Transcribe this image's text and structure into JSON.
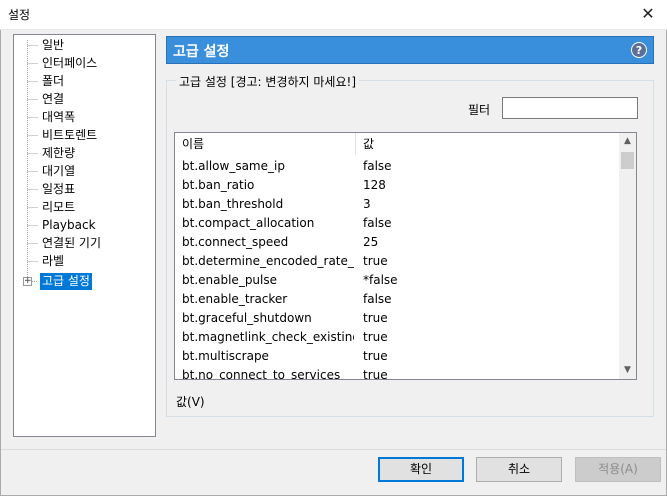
{
  "window": {
    "title": "설정",
    "close_glyph": "✕"
  },
  "tree": {
    "items": [
      {
        "label": "일반"
      },
      {
        "label": "인터페이스"
      },
      {
        "label": "폴더"
      },
      {
        "label": "연결"
      },
      {
        "label": "대역폭"
      },
      {
        "label": "비트토렌트"
      },
      {
        "label": "제한량"
      },
      {
        "label": "대기열"
      },
      {
        "label": "일정표"
      },
      {
        "label": "리모트"
      },
      {
        "label": "Playback"
      },
      {
        "label": "연결된 기기"
      },
      {
        "label": "라벨"
      },
      {
        "label": "고급 설정",
        "selected": true
      }
    ],
    "expander_glyph": "+"
  },
  "header": {
    "title": "고급 설정",
    "help_glyph": "?"
  },
  "group": {
    "legend": "고급 설정 [경고: 변경하지 마세요!]",
    "filter_label": "필터",
    "filter_value": ""
  },
  "listview": {
    "columns": {
      "name": "이름",
      "value": "값"
    },
    "rows": [
      {
        "name": "bt.allow_same_ip",
        "value": "false"
      },
      {
        "name": "bt.ban_ratio",
        "value": "128"
      },
      {
        "name": "bt.ban_threshold",
        "value": "3"
      },
      {
        "name": "bt.compact_allocation",
        "value": "false"
      },
      {
        "name": "bt.connect_speed",
        "value": "25"
      },
      {
        "name": "bt.determine_encoded_rate_fo...",
        "value": "true"
      },
      {
        "name": "bt.enable_pulse",
        "value": "*false"
      },
      {
        "name": "bt.enable_tracker",
        "value": "false"
      },
      {
        "name": "bt.graceful_shutdown",
        "value": "true"
      },
      {
        "name": "bt.magnetlink_check_existing_...",
        "value": "true"
      },
      {
        "name": "bt.multiscrape",
        "value": "true"
      },
      {
        "name": "bt.no_connect_to_services",
        "value": "true"
      }
    ]
  },
  "value_label": "값(V)",
  "buttons": {
    "ok": "확인",
    "cancel": "취소",
    "apply": "적용(A)"
  },
  "colors": {
    "accent": "#0078d7",
    "header_bg": "#3a8fdc"
  }
}
